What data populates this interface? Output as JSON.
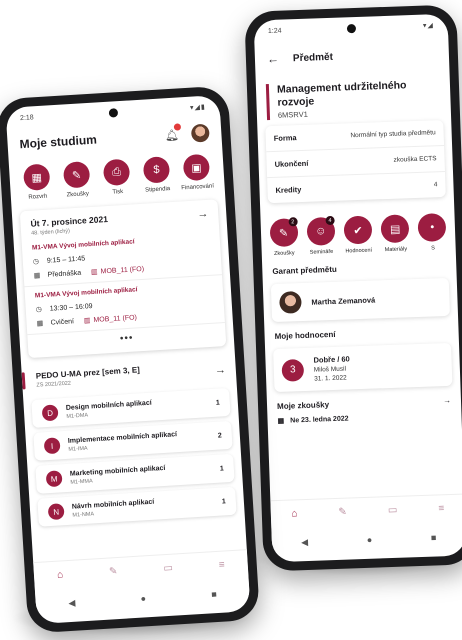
{
  "colors": {
    "accent": "#9c1d41",
    "text": "#1d1b20",
    "muted": "#777777"
  },
  "front": {
    "status_time": "2:18",
    "status_icons": "▾◢▮",
    "title": "Moje studium",
    "bell_icon": "bell-icon",
    "quick_actions": [
      {
        "label": "Rozvrh",
        "icon": "calendar-icon",
        "glyph": "▦"
      },
      {
        "label": "Zkoušky",
        "icon": "pencil-icon",
        "glyph": "✎"
      },
      {
        "label": "Tisk",
        "icon": "printer-icon",
        "glyph": "⎙"
      },
      {
        "label": "Stipendia",
        "icon": "dollar-icon",
        "glyph": "$"
      },
      {
        "label": "Financování",
        "icon": "wallet-icon",
        "glyph": "▣"
      }
    ],
    "day": {
      "date": "Út 7. prosince 2021",
      "week": "48. týden (lichý)",
      "lessons": [
        {
          "code": "M1-VMA Vývoj mobilních aplikací",
          "time": "9:15 – 11:45",
          "type": "Přednáška",
          "room": "MOB_11 (FO)"
        },
        {
          "code": "M1-VMA Vývoj mobilních aplikací",
          "time": "13:30 – 16:09",
          "type": "Cvičení",
          "room": "MOB_11 (FO)"
        }
      ],
      "more": "•••"
    },
    "pedo": {
      "title": "PEDO U-MA prez [sem 3, E]",
      "subtitle": "ZS 2021/2022"
    },
    "subjects": [
      {
        "letter": "D",
        "name": "Design mobilních aplikací",
        "code": "M1-DMA",
        "count": "1"
      },
      {
        "letter": "I",
        "name": "Implementace mobilních aplikací",
        "code": "M1-IMA",
        "count": "2"
      },
      {
        "letter": "M",
        "name": "Marketing mobilních aplikací",
        "code": "M1-MMA",
        "count": "1"
      },
      {
        "letter": "N",
        "name": "Návrh mobilních aplikací",
        "code": "M1-NMA",
        "count": "1"
      }
    ],
    "nav": {
      "home": "⌂",
      "grades": "✎",
      "folder": "▭",
      "menu": "≡"
    },
    "sysnav": {
      "back": "◀",
      "home": "●",
      "recent": "■"
    }
  },
  "back": {
    "status_time": "1:24",
    "status_icons": "▾◢",
    "title": "Předmět",
    "subject_name": "Management udržitelného rozvoje",
    "subject_code": "6MSRV1",
    "info": [
      {
        "key": "Forma",
        "value": "Normální typ studia předmětu"
      },
      {
        "key": "Ukončení",
        "value": "zkouška ECTS"
      },
      {
        "key": "Kredity",
        "value": "4"
      }
    ],
    "actions": [
      {
        "label": "Zkoušky",
        "icon": "exam-icon",
        "glyph": "✎",
        "badge": "2"
      },
      {
        "label": "Semináře",
        "icon": "seminar-icon",
        "glyph": "☺",
        "badge": "4"
      },
      {
        "label": "Hodnocení",
        "icon": "thumbs-up-icon",
        "glyph": "✔",
        "badge": ""
      },
      {
        "label": "Materiály",
        "icon": "book-icon",
        "glyph": "▤",
        "badge": ""
      },
      {
        "label": "S",
        "icon": "more-icon",
        "glyph": "•",
        "badge": ""
      }
    ],
    "guarantor_title": "Garant předmětu",
    "guarantor_name": "Martha Zemanová",
    "grades_title": "Moje hodnocení",
    "grade": {
      "number": "3",
      "grade": "Dobře / 60",
      "person": "Miloš Musil",
      "date": "31. 1. 2022"
    },
    "exams_title": "Moje zkoušky",
    "exam_date": "Ne 23. ledna 2022",
    "nav": {
      "home": "⌂",
      "grades": "✎",
      "folder": "▭",
      "menu": "≡"
    },
    "sysnav": {
      "back": "◀",
      "home": "●",
      "recent": "■"
    }
  }
}
